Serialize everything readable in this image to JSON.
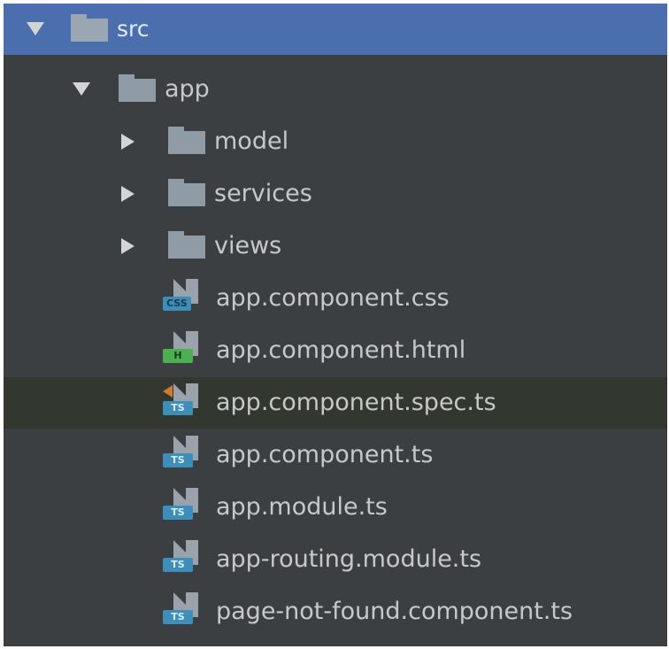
{
  "tree": {
    "root": {
      "label": "src",
      "expanded": true,
      "icon": "folder-icon"
    },
    "app": {
      "label": "app",
      "expanded": true,
      "icon": "folder-icon"
    },
    "folders": [
      {
        "label": "model",
        "expanded": false,
        "icon": "folder-icon"
      },
      {
        "label": "services",
        "expanded": false,
        "icon": "folder-icon"
      },
      {
        "label": "views",
        "expanded": false,
        "icon": "folder-icon"
      }
    ],
    "files": [
      {
        "label": "app.component.css",
        "badge": "CSS",
        "icon": "css-file-icon"
      },
      {
        "label": "app.component.html",
        "badge": "H",
        "icon": "html-file-icon"
      },
      {
        "label": "app.component.spec.ts",
        "badge": "TS",
        "icon": "test-ts-file-icon",
        "highlighted": true
      },
      {
        "label": "app.component.ts",
        "badge": "TS",
        "icon": "ts-file-icon"
      },
      {
        "label": "app.module.ts",
        "badge": "TS",
        "icon": "ts-file-icon"
      },
      {
        "label": "app-routing.module.ts",
        "badge": "TS",
        "icon": "ts-file-icon"
      },
      {
        "label": "page-not-found.component.ts",
        "badge": "TS",
        "icon": "ts-file-icon"
      }
    ]
  },
  "colors": {
    "panel_background": "#3c3f41",
    "selection": "#4b6eaf",
    "highlight_row": "#32382f",
    "folder": "#8f9ba5",
    "ts_badge": "#3d8eb9",
    "html_badge": "#4caf50",
    "test_marker": "#d47a2b"
  }
}
